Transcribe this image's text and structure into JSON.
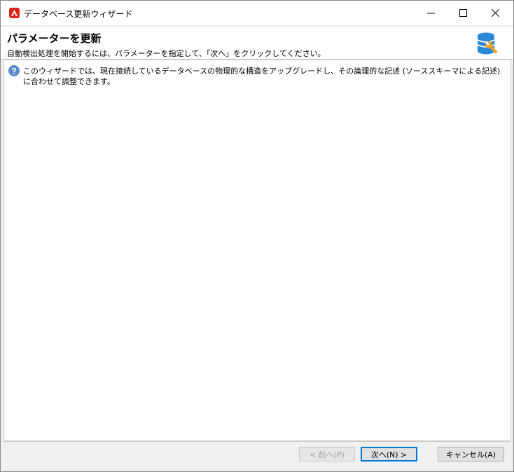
{
  "window": {
    "title": "データベース更新ウィザード",
    "minimize_glyph": "—",
    "maximize_glyph": "☐",
    "close_glyph": "✕"
  },
  "header": {
    "title": "パラメーターを更新",
    "subtitle": "自動検出処理を開始するには、パラメーターを指定して、「次へ」をクリックしてください。",
    "icon": "database-wrench-icon"
  },
  "content": {
    "info_icon": "question-icon",
    "description": "このウィザードでは、現在接続しているデータベースの物理的な構造をアップグレードし、その論理的な記述 (ソーススキーマによる記述) に合わせて調整できます。"
  },
  "buttons": {
    "back": "< 前へ(P)",
    "next": "次へ(N) >",
    "cancel": "キャンセル(A)"
  },
  "colors": {
    "accent": "#0078d7",
    "app_icon": "#e1251b",
    "db_icon": "#2b8ad8",
    "wrench": "#f0a020"
  }
}
